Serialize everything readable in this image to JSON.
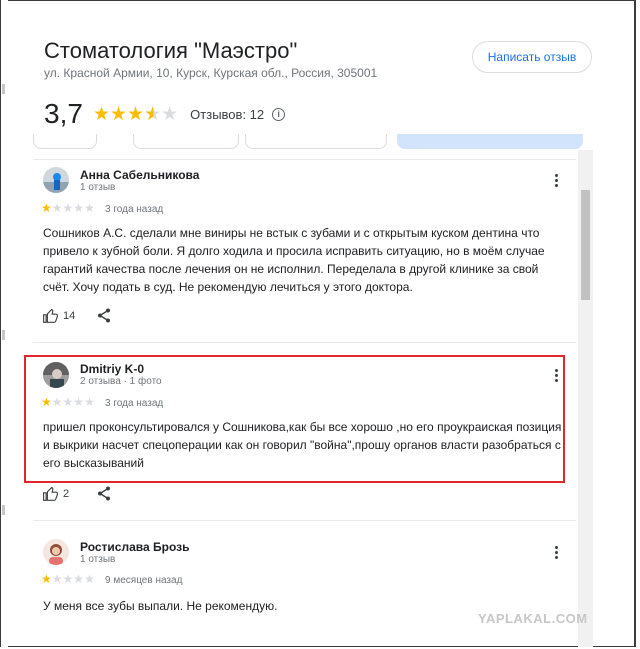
{
  "place": {
    "title": "Стоматология \"Маэстро\"",
    "address": "ул. Красной Армии, 10, Курск, Курская обл., Россия, 305001",
    "write_review_label": "Написать отзыв"
  },
  "rating": {
    "value": "3,7",
    "stars": 3.7,
    "reviews_label": "Отзывов: 12"
  },
  "reviews": [
    {
      "author": "Анна Сабельникова",
      "meta": "1 отзыв",
      "stars": 1,
      "date": "3 года назад",
      "text": "Сошников А.С. сделали мне виниры не встык с зубами и с открытым куском дентина что привело к зубной боли. Я долго ходила и просила исправить ситуацию, но в моём случае гарантий качества после лечения он не исполнил. Переделала в другой клинике за свой счёт. Хочу подать в суд. Не рекомендую лечиться у этого доктора.",
      "likes": "14"
    },
    {
      "author": "Dmitriy K-0",
      "meta": "2 отзыва · 1 фото",
      "stars": 1,
      "date": "3 года назад",
      "text": "пришел проконсультировался у Сошникова,как бы все хорошо ,но его проукраиская позиция и выкрики насчет спецоперации как он говорил \"война\",прошу органов власти разобраться с его высказываний",
      "likes": "2"
    },
    {
      "author": "Ростислава Брозь",
      "meta": "1 отзыв",
      "stars": 1,
      "date": "9 месяцев назад",
      "text": "У меня все зубы выпали. Не рекомендую."
    }
  ],
  "watermark": "YAPLAKAL.COM",
  "colors": {
    "accent": "#1a73e8",
    "star": "#fbbc04",
    "highlight": "#e0252b"
  }
}
